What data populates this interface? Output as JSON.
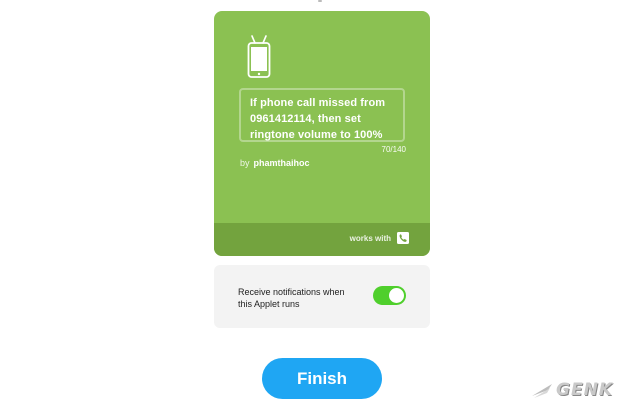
{
  "applet": {
    "title": "If phone call missed from 0961412114, then set ringtone volume to 100%",
    "char_count": "70/140",
    "by_label": "by",
    "author": "phamthaihoc",
    "works_with_label": "works with",
    "card_color": "#8bc152",
    "footer_color": "#73a33e",
    "icons": {
      "trigger": "android-phone-icon",
      "service": "phone-call-icon"
    }
  },
  "notifications": {
    "label": "Receive notifications when this Applet runs",
    "toggle_on": true,
    "toggle_color": "#4fcf2c"
  },
  "actions": {
    "finish_label": "Finish",
    "finish_color": "#1fa6f3"
  },
  "watermark": {
    "text": "GENK"
  }
}
